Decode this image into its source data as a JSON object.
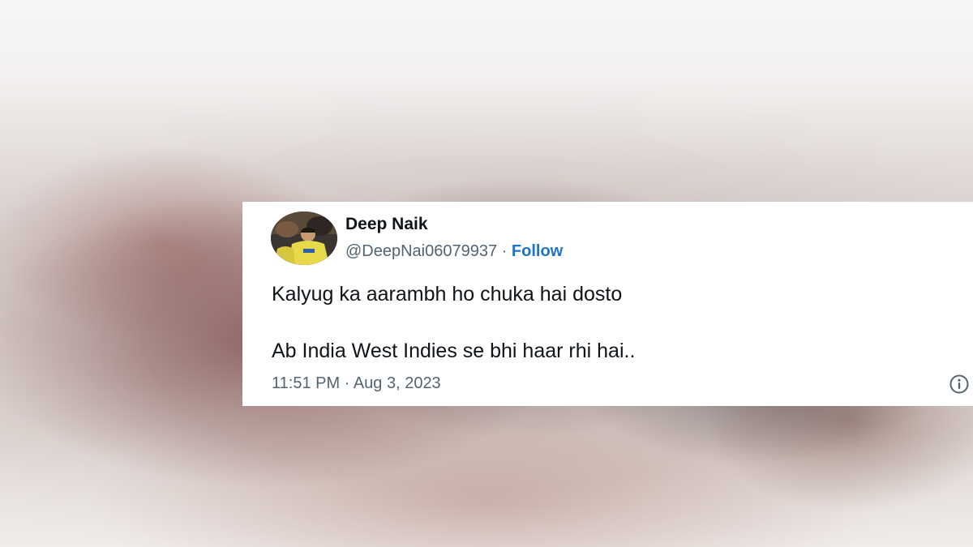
{
  "tweet": {
    "author_name": "Deep Naik",
    "handle": "@DeepNai06079937",
    "separator": "·",
    "follow_label": "Follow",
    "text_lines": [
      "Kalyug ka aarambh ho chuka hai dosto",
      "Ab India West Indies se bhi haar rhi hai.."
    ],
    "time": "11:51 PM",
    "date": "Aug 3, 2023",
    "avatar_icon": "profile-photo",
    "info_icon": "info-icon"
  },
  "colors": {
    "follow_link": "#1d73c7",
    "text_primary": "#0f1419",
    "text_secondary": "#536471",
    "avatar_shirt": "#e8d94a"
  }
}
